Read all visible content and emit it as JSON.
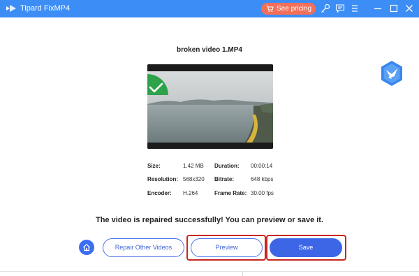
{
  "titlebar": {
    "app_name": "Tipard FixMP4",
    "pricing_label": "See pricing",
    "icons": [
      "key-icon",
      "feedback-icon",
      "menu-icon",
      "minimize-icon",
      "maximize-icon",
      "close-icon"
    ]
  },
  "colors": {
    "titlebar": "#3c8ef6",
    "pricing": "#f46f5a",
    "primary": "#3d66e6",
    "success": "#2ea24a",
    "highlight": "#c8261f"
  },
  "video": {
    "file_name": "broken video 1.MP4"
  },
  "info": {
    "size": {
      "label": "Size:",
      "value": "1.42 MB"
    },
    "duration": {
      "label": "Duration:",
      "value": "00:00:14"
    },
    "resolution": {
      "label": "Resolution:",
      "value": "568x320"
    },
    "bitrate": {
      "label": "Bitrate:",
      "value": "648 kbps"
    },
    "encoder": {
      "label": "Encoder:",
      "value": "H.264"
    },
    "frame_rate": {
      "label": "Frame Rate:",
      "value": "30.00 fps"
    }
  },
  "status": {
    "message": "The video is repaired successfully! You can preview or save it."
  },
  "actions": {
    "repair_other_label": "Repair Other Videos",
    "preview_label": "Preview",
    "save_label": "Save"
  }
}
